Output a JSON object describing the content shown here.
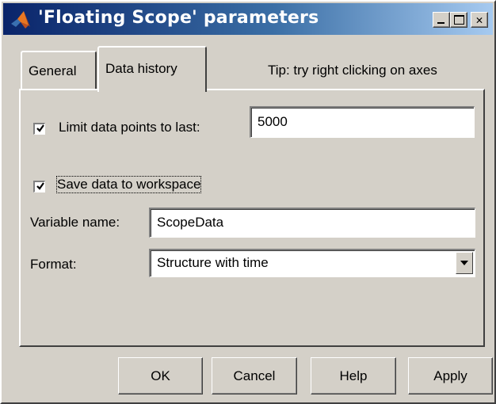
{
  "window": {
    "title": "'Floating Scope' parameters",
    "icon": "matlab-logo-icon"
  },
  "caption_buttons": {
    "minimize": "_",
    "maximize": "□",
    "close": "✕"
  },
  "tabs": [
    {
      "label": "General",
      "selected": false
    },
    {
      "label": "Data history",
      "selected": true
    }
  ],
  "tip": "Tip: try right clicking on axes",
  "data_history": {
    "limit_points": {
      "checked": true,
      "label": "Limit data points to last:",
      "value": "5000"
    },
    "save_to_workspace": {
      "checked": true,
      "label": "Save data to workspace"
    },
    "variable_name": {
      "label": "Variable name:",
      "value": "ScopeData"
    },
    "format": {
      "label": "Format:",
      "selected": "Structure with time"
    }
  },
  "buttons": {
    "ok": "OK",
    "cancel": "Cancel",
    "help": "Help",
    "apply": "Apply"
  },
  "colors": {
    "face": "#d4d0c8",
    "titlebar_start": "#0a246a",
    "titlebar_end": "#a6caf0"
  }
}
